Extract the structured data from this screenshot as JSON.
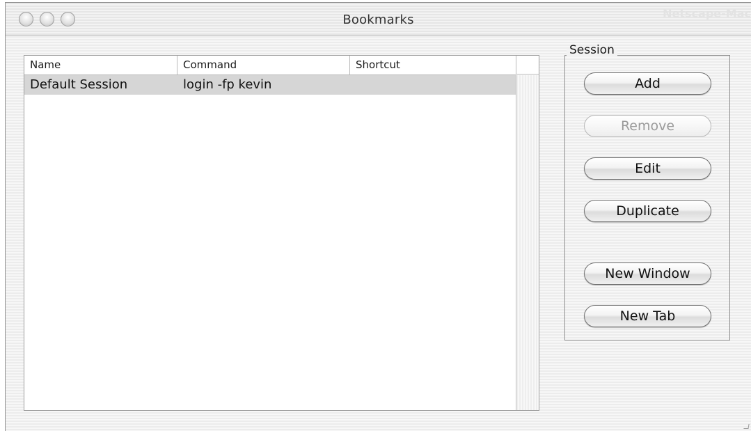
{
  "window": {
    "title": "Bookmarks",
    "app_name": "Netscape-Mac"
  },
  "table": {
    "columns": [
      "Name",
      "Command",
      "Shortcut"
    ],
    "rows": [
      {
        "name": "Default Session",
        "command": "login -fp kevin",
        "shortcut": ""
      }
    ],
    "selected_row": 0
  },
  "session": {
    "legend": "Session",
    "buttons": {
      "add": "Add",
      "remove": "Remove",
      "edit": "Edit",
      "duplicate": "Duplicate",
      "new_window": "New Window",
      "new_tab": "New Tab"
    },
    "remove_enabled": false
  },
  "colors": {
    "selection": "#d6d6d6",
    "disabled_text": "#9a9a9a"
  }
}
